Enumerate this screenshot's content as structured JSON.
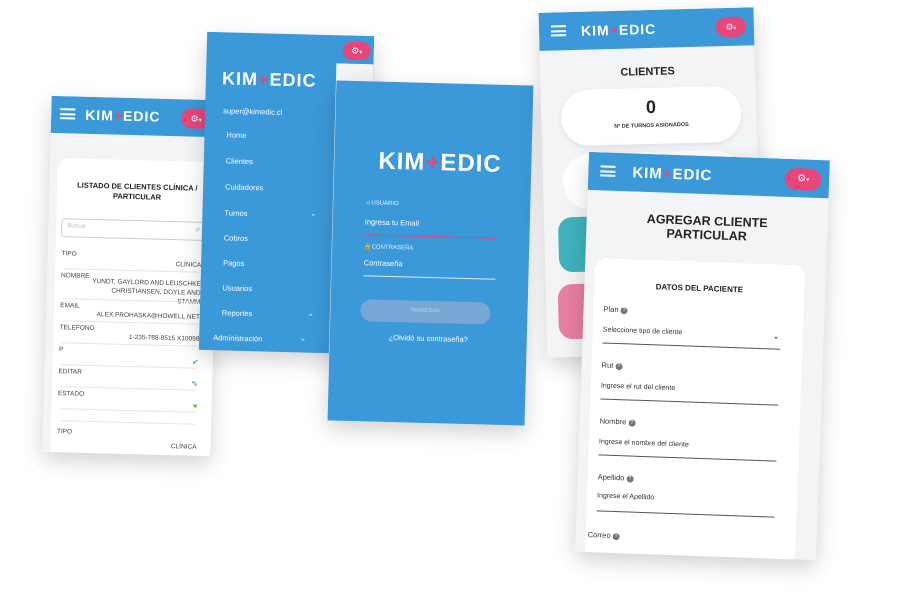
{
  "brand": {
    "name_part1": "KIM",
    "name_plus": "+",
    "name_part2": "EDIC"
  },
  "colors": {
    "primary": "#3b99d9",
    "accent": "#e8457a",
    "teal": "#3fb2bd",
    "pink": "#e87fa2"
  },
  "settings_button": {
    "icon": "gear-icon",
    "caret": "▾"
  },
  "list_screen": {
    "title": "LISTADO DE CLIENTES CLÍNICA / PARTICULAR",
    "search_placeholder": "Buscar",
    "rows": [
      {
        "label": "TIPO",
        "value": "CLÍNICA"
      },
      {
        "label": "NOMBRE",
        "value": "YUNDT, GAYLORD AND LEUSCHKE CHRISTIANSEN, DOYLE AND STAMM"
      },
      {
        "label": "EMAIL",
        "value": "ALEX.PROHASKA@HOWELL.NET"
      },
      {
        "label": "TELEFONO",
        "value": "1-235-788-8515 X10098"
      },
      {
        "label": "P",
        "value": "✔"
      },
      {
        "label": "EDITAR",
        "value": "✎"
      },
      {
        "label": "ESTADO",
        "value": "♥"
      }
    ],
    "next_row": {
      "label": "TIPO",
      "value": "CLÍNICA"
    }
  },
  "menu_screen": {
    "email": "super@kimedic.cl",
    "items": [
      "Home",
      "Clientes",
      "Cuidadores",
      "Turnos",
      "Cobros",
      "Pagos",
      "Usuarios",
      "Reportes",
      "Administración"
    ]
  },
  "login_screen": {
    "user_label": "USUARIO",
    "user_placeholder": "Ingresa tu Email",
    "password_label": "CONTRASEÑA",
    "password_placeholder": "Contraseña",
    "submit_label": "INGRESAR",
    "forgot_link": "¿Olvidó su contraseña?"
  },
  "clients_screen": {
    "title": "CLIENTES",
    "turns_count": "0",
    "turns_label": "Nº DE TURNOS ASIGNADOS"
  },
  "form_screen": {
    "title_line1": "AGREGAR CLIENTE",
    "title_line2": "PARTICULAR",
    "section_title": "DATOS DEL PACIENTE",
    "fields": [
      {
        "label": "Plan",
        "value": "Seleccione tipo de cliente"
      },
      {
        "label": "Rut",
        "value": "Ingrese el rut del cliente"
      },
      {
        "label": "Nombre",
        "value": "Ingrese el nombre del cliente"
      },
      {
        "label": "Apellido",
        "value": "Ingrese el Apellido"
      },
      {
        "label": "Correo",
        "value": ""
      }
    ],
    "help_icon": "?"
  }
}
